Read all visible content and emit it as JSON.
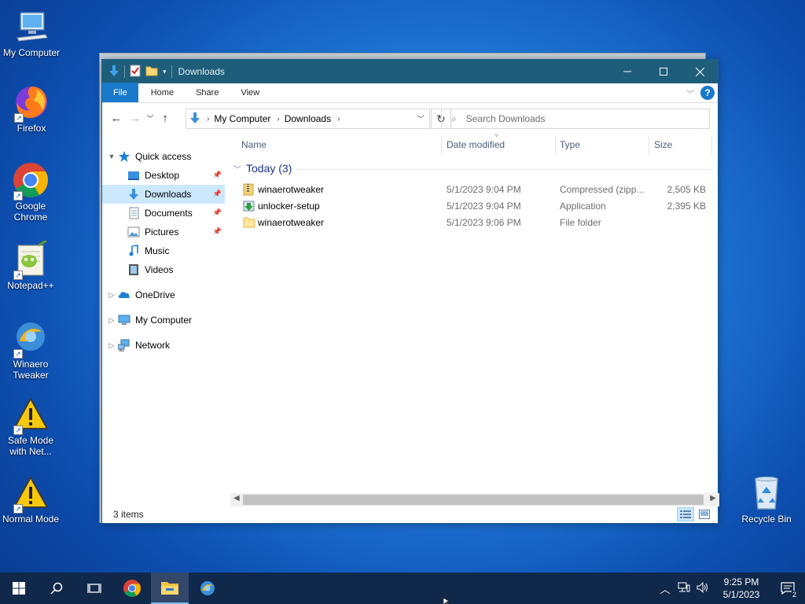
{
  "desktop": {
    "icons": [
      {
        "label": "My Computer"
      },
      {
        "label": "Firefox"
      },
      {
        "label": "Google Chrome"
      },
      {
        "label": "Notepad++"
      },
      {
        "label": "Winaero Tweaker"
      },
      {
        "label": "Safe Mode with Net..."
      },
      {
        "label": "Normal Mode"
      },
      {
        "label": "Recycle Bin"
      }
    ]
  },
  "window": {
    "title": "Downloads",
    "ribbon_tabs": [
      "File",
      "Home",
      "Share",
      "View"
    ],
    "address": {
      "crumbs": [
        "My Computer",
        "Downloads"
      ]
    },
    "search": {
      "placeholder": "Search Downloads"
    },
    "nav": {
      "quick_access": "Quick access",
      "items": [
        "Desktop",
        "Downloads",
        "Documents",
        "Pictures",
        "Music",
        "Videos"
      ],
      "onedrive": "OneDrive",
      "my_computer": "My Computer",
      "network": "Network"
    },
    "columns": [
      "Name",
      "Date modified",
      "Type",
      "Size"
    ],
    "group": "Today (3)",
    "files": [
      {
        "name": "winaerotweaker",
        "date": "5/1/2023 9:04 PM",
        "type": "Compressed (zipp...",
        "size": "2,505 KB"
      },
      {
        "name": "unlocker-setup",
        "date": "5/1/2023 9:04 PM",
        "type": "Application",
        "size": "2,395 KB"
      },
      {
        "name": "winaerotweaker",
        "date": "5/1/2023 9:06 PM",
        "type": "File folder",
        "size": ""
      }
    ],
    "status": "3 items"
  },
  "taskbar": {
    "time": "9:25 PM",
    "date": "5/1/2023",
    "notifications": "2"
  },
  "colors": {
    "titlebar": "#1f5e7a",
    "file_tab": "#1979ca",
    "selection": "#cce8ff",
    "taskbar": "#10284a"
  }
}
